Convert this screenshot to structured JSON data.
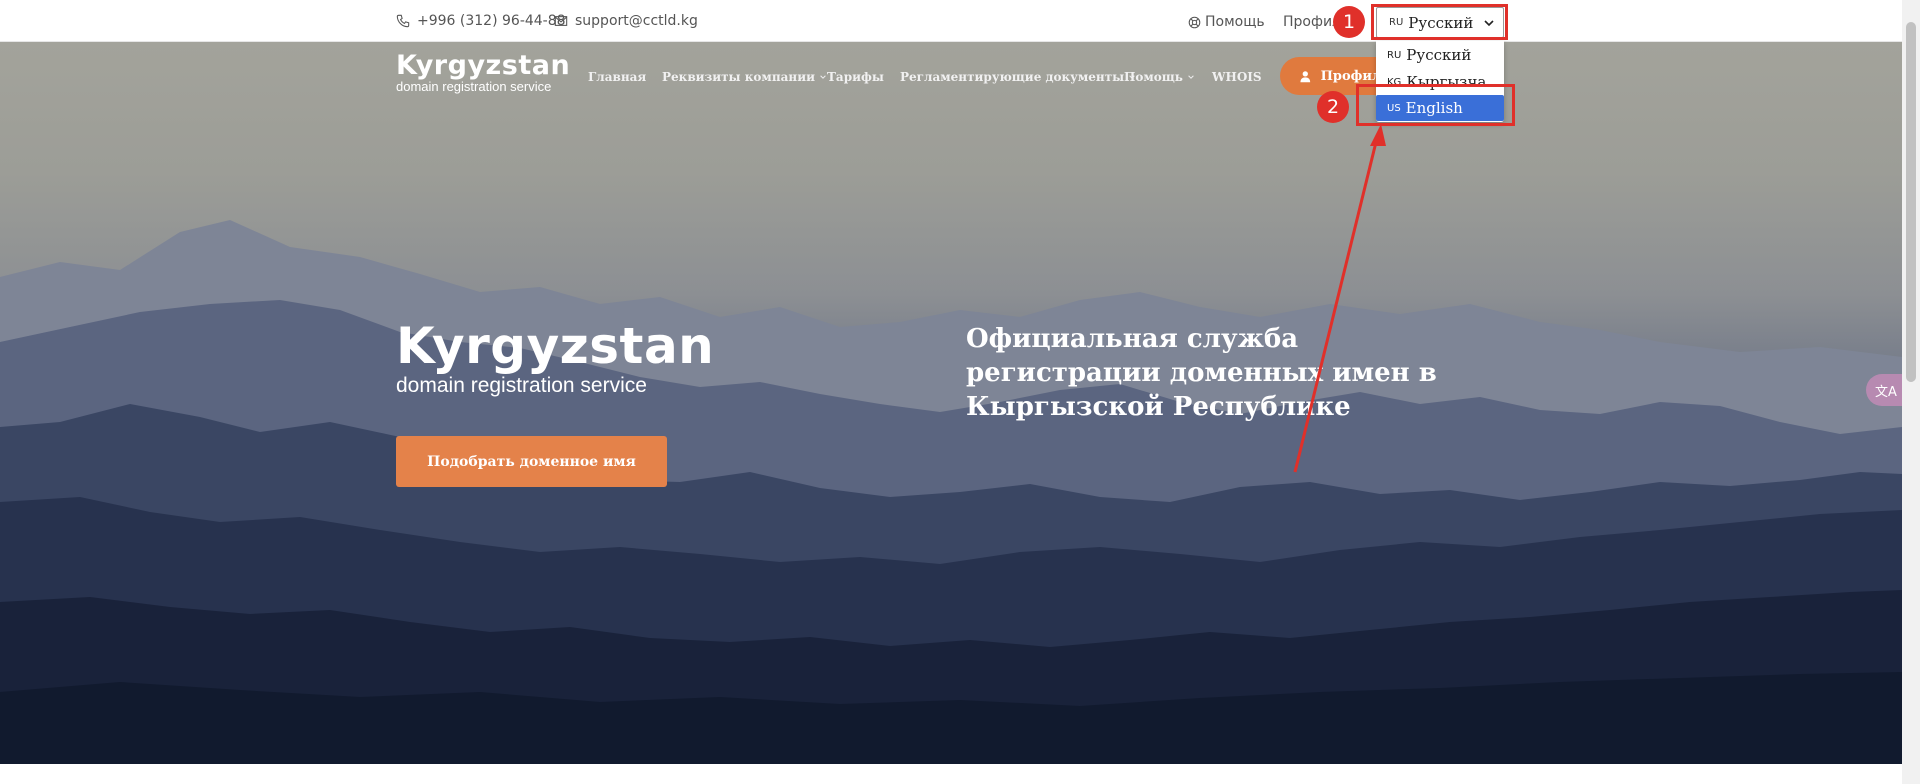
{
  "topbar": {
    "phone": "+996 (312) 96-44-88",
    "email": "support@cctld.kg",
    "help_label": "Помощь",
    "profile_label": "Профиль"
  },
  "language": {
    "selected_code": "RU",
    "selected_label": "Русский",
    "options": [
      {
        "code": "RU",
        "label": "Русский"
      },
      {
        "code": "KG",
        "label": "Кыргызча"
      },
      {
        "code": "US",
        "label": "English"
      }
    ]
  },
  "header": {
    "logo_title": "Kyrgyzstan",
    "logo_subtitle": "domain registration service",
    "nav": [
      "Главная",
      "Реквизиты компании",
      "Тарифы",
      "Регламентирующие документы",
      "Помощь",
      "WHOIS"
    ],
    "profile_button": "Профиль"
  },
  "hero": {
    "logo_title": "Kyrgyzstan",
    "logo_subtitle": "domain registration service",
    "cta_label": "Подобрать доменное имя",
    "headline": "Официальная служба регистрации доменных имен в Кыргызской Республике"
  },
  "annotations": {
    "step1": "1",
    "step2": "2"
  },
  "colors": {
    "accent": "#e4824a",
    "annotation": "#e0302a",
    "selected_option": "#3a6fd8"
  }
}
